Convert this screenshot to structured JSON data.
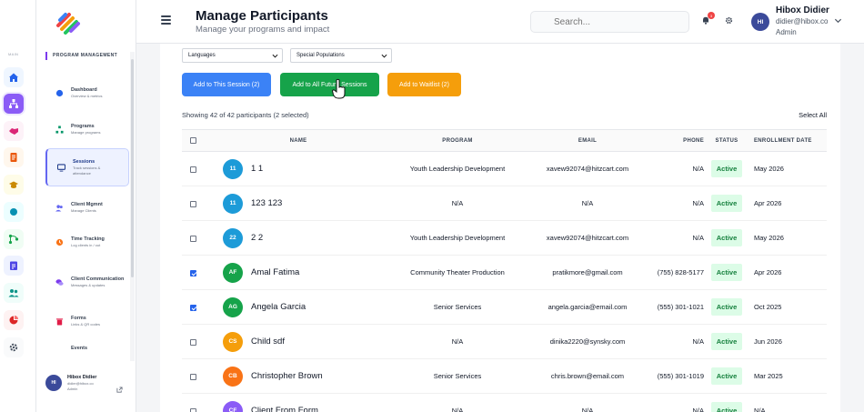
{
  "colors": {
    "accent": "#7c3aed",
    "primary": "#3b82f6",
    "success": "#16a34a",
    "warning": "#f59e0b",
    "badge_bg": "#dcfce7"
  },
  "rail": {
    "label": "MAIN",
    "icons": [
      "home-icon",
      "org-chart-icon",
      "handshake-icon",
      "document-icon",
      "graduation-cap-icon",
      "circle-icon",
      "flow-icon",
      "clipboard-icon",
      "users-icon",
      "chart-pie-icon",
      "gear-icon"
    ]
  },
  "subnav": {
    "heading": "PROGRAM MANAGEMENT",
    "items": [
      {
        "title": "Dashboard",
        "sub": "Overview & metrics",
        "icon": "dashboard-icon"
      },
      {
        "title": "Programs",
        "sub": "Manage programs",
        "icon": "org-chart-icon"
      },
      {
        "title": "Sessions",
        "sub": "Track sessions & attendance",
        "icon": "monitor-icon"
      },
      {
        "title": "Client Mgmnt",
        "sub": "Manage Clients",
        "icon": "users-icon"
      },
      {
        "title": "Time Tracking",
        "sub": "Log clients in / out",
        "icon": "clock-icon"
      },
      {
        "title": "Client Communication",
        "sub": "Messages & updates",
        "icon": "chat-icon"
      },
      {
        "title": "Forms",
        "sub": "Links & QR codes",
        "icon": "trash-icon"
      },
      {
        "title": "Events",
        "sub": "",
        "icon": ""
      }
    ],
    "user": {
      "initials": "HI",
      "name": "Hibox Didier",
      "email": "didier@hibox.co",
      "role": "Admin"
    }
  },
  "header": {
    "title": "Manage Participants",
    "subtitle": "Manage your programs and impact",
    "search_placeholder": "Search...",
    "notif_count": "3",
    "user": {
      "initials": "HI",
      "name": "Hibox Didier",
      "email": "didier@hibox.co",
      "role": "Admin"
    }
  },
  "filters": {
    "languages": "Languages",
    "populations": "Special Populations"
  },
  "actions": {
    "this_session": "Add to This Session (2)",
    "future_sessions": "Add to All Future Sessions",
    "waitlist": "Add to Waitlist (2)"
  },
  "summary": {
    "showing": "Showing 42 of 42 participants (2 selected)",
    "select_all": "Select All"
  },
  "table": {
    "headers": [
      "NAME",
      "PROGRAM",
      "EMAIL",
      "PHONE",
      "STATUS",
      "ENROLLMENT DATE"
    ],
    "rows": [
      {
        "checked": false,
        "initials": "11",
        "av": "#1d9bd8",
        "name": "1 1",
        "program": "Youth Leadership Development",
        "email": "xavew92074@hitzcart.com",
        "phone": "N/A",
        "status": "Active",
        "date": "May 2026"
      },
      {
        "checked": false,
        "initials": "11",
        "av": "#1d9bd8",
        "name": "123 123",
        "program": "N/A",
        "email": "N/A",
        "phone": "N/A",
        "status": "Active",
        "date": "Apr 2026"
      },
      {
        "checked": false,
        "initials": "22",
        "av": "#1d9bd8",
        "name": "2 2",
        "program": "Youth Leadership Development",
        "email": "xavew92074@hitzcart.com",
        "phone": "N/A",
        "status": "Active",
        "date": "May 2026"
      },
      {
        "checked": true,
        "initials": "AF",
        "av": "#16a34a",
        "name": "Amal Fatima",
        "program": "Community Theater Production",
        "email": "pratikmore@gmail.com",
        "phone": "(755) 828-5177",
        "status": "Active",
        "date": "Apr 2026"
      },
      {
        "checked": true,
        "initials": "AG",
        "av": "#16a34a",
        "name": "Angela Garcia",
        "program": "Senior Services",
        "email": "angela.garcia@email.com",
        "phone": "(555) 301-1021",
        "status": "Active",
        "date": "Oct 2025"
      },
      {
        "checked": false,
        "initials": "CS",
        "av": "#f59e0b",
        "name": "Child sdf",
        "program": "N/A",
        "email": "dinika2220@synsky.com",
        "phone": "N/A",
        "status": "Active",
        "date": "Jun 2026"
      },
      {
        "checked": false,
        "initials": "CB",
        "av": "#f97316",
        "name": "Christopher Brown",
        "program": "Senior Services",
        "email": "chris.brown@email.com",
        "phone": "(555) 301-1019",
        "status": "Active",
        "date": "Mar 2025"
      },
      {
        "checked": false,
        "initials": "CF",
        "av": "#8b5cf6",
        "name": "Client From Form",
        "program": "N/A",
        "email": "N/A",
        "phone": "N/A",
        "status": "Active",
        "date": "N/A"
      }
    ]
  }
}
